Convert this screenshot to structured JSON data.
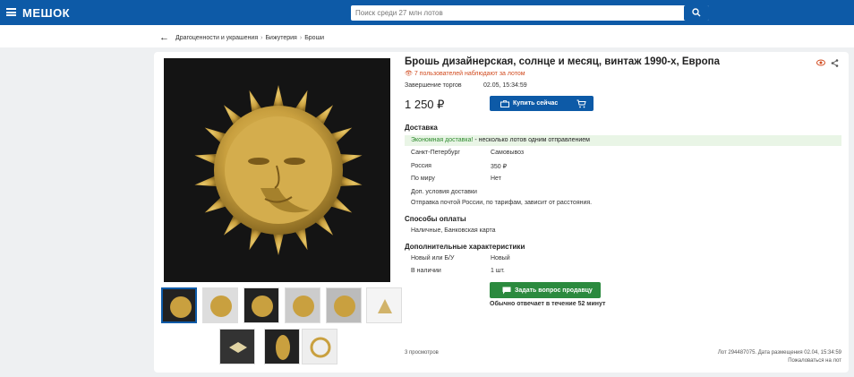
{
  "header": {
    "logo": "МЕШОК",
    "search_placeholder": "Поиск среди 27 млн лотов"
  },
  "breadcrumb": [
    "Драгоценности и украшения",
    "Бижутерия",
    "Броши"
  ],
  "lot": {
    "title": "Брошь дизайнерская, солнце и месяц, винтаж 1990-х, Европа",
    "watchers": "7 пользователей наблюдают за лотом",
    "end_label": "Завершение торгов",
    "end_value": "02.05, 15:34:59",
    "price": "1 250 ₽",
    "buy_label": "Купить сейчас"
  },
  "delivery": {
    "title": "Доставка",
    "econ_green": "Экономная доставка!",
    "econ_rest": " - несколько лотов одним отправлением",
    "rows": [
      {
        "label": "Санкт-Петербург",
        "value": "Самовывоз"
      },
      {
        "label": "Россия",
        "value": "350 ₽"
      },
      {
        "label": "По миру",
        "value": "Нет"
      }
    ],
    "extra_label": "Доп. условия доставки",
    "extra_value": "Отправка почтой России, по тарифам, зависит от расстояния."
  },
  "payment": {
    "title": "Способы оплаты",
    "value": "Наличные, Банковская карта"
  },
  "characteristics": {
    "title": "Дополнительные характеристики",
    "rows": [
      {
        "label": "Новый или Б/У",
        "value": "Новый"
      },
      {
        "label": "В наличии",
        "value": "1 шт."
      }
    ]
  },
  "ask": {
    "button": "Задать вопрос продавцу",
    "note": "Обычно отвечает в течение 52 минут"
  },
  "footer": {
    "views": "3 просмотров",
    "lot_info": "Лот 294487075. Дата размещения 02.04, 15:34:59",
    "report": "Пожаловаться на лот"
  },
  "colors": {
    "brand": "#0d5aa7",
    "green": "#2b8a3e",
    "alert": "#d14a1e"
  }
}
